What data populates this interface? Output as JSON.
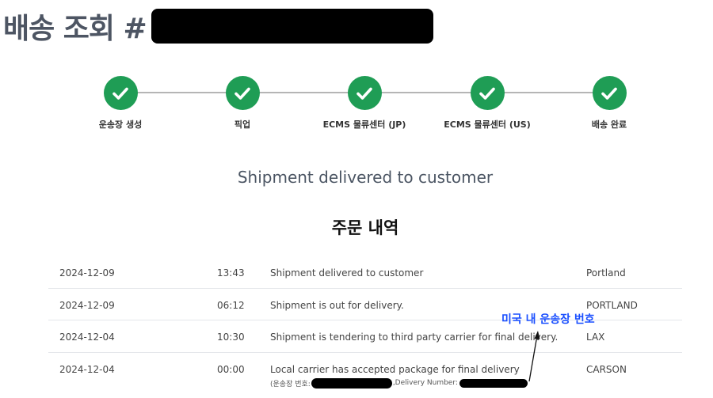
{
  "header": {
    "title": "배송 조회 #"
  },
  "progress": {
    "steps": [
      {
        "label": "운송장 생성",
        "icon": "check-icon"
      },
      {
        "label": "픽업",
        "icon": "check-icon"
      },
      {
        "label": "ECMS 물류센터 (JP)",
        "icon": "check-icon"
      },
      {
        "label": "ECMS 물류센터 (US)",
        "icon": "check-icon"
      },
      {
        "label": "배송 완료",
        "icon": "check-icon"
      }
    ],
    "completed_steps": 5,
    "total_steps": 5,
    "color": "#1f9d55"
  },
  "status": {
    "text": "Shipment delivered to customer"
  },
  "history": {
    "title": "주문 내역",
    "rows": [
      {
        "date": "2024-12-09",
        "time": "13:43",
        "description": "Shipment delivered to customer",
        "location": "Portland"
      },
      {
        "date": "2024-12-09",
        "time": "06:12",
        "description": "Shipment is out for delivery.",
        "location": "PORTLAND"
      },
      {
        "date": "2024-12-04",
        "time": "10:30",
        "description": "Shipment is tendering to third party carrier for final delivery.",
        "location": "LAX"
      },
      {
        "date": "2024-12-04",
        "time": "00:00",
        "description": "Local carrier has accepted package for final delivery",
        "location": "CARSON",
        "sub_prefix": "(운송장 번호:",
        "sub_middle": ",Delivery Number:"
      }
    ]
  },
  "annotation": {
    "text": "미국 내 운송장 번호",
    "color": "#1a4fff"
  }
}
